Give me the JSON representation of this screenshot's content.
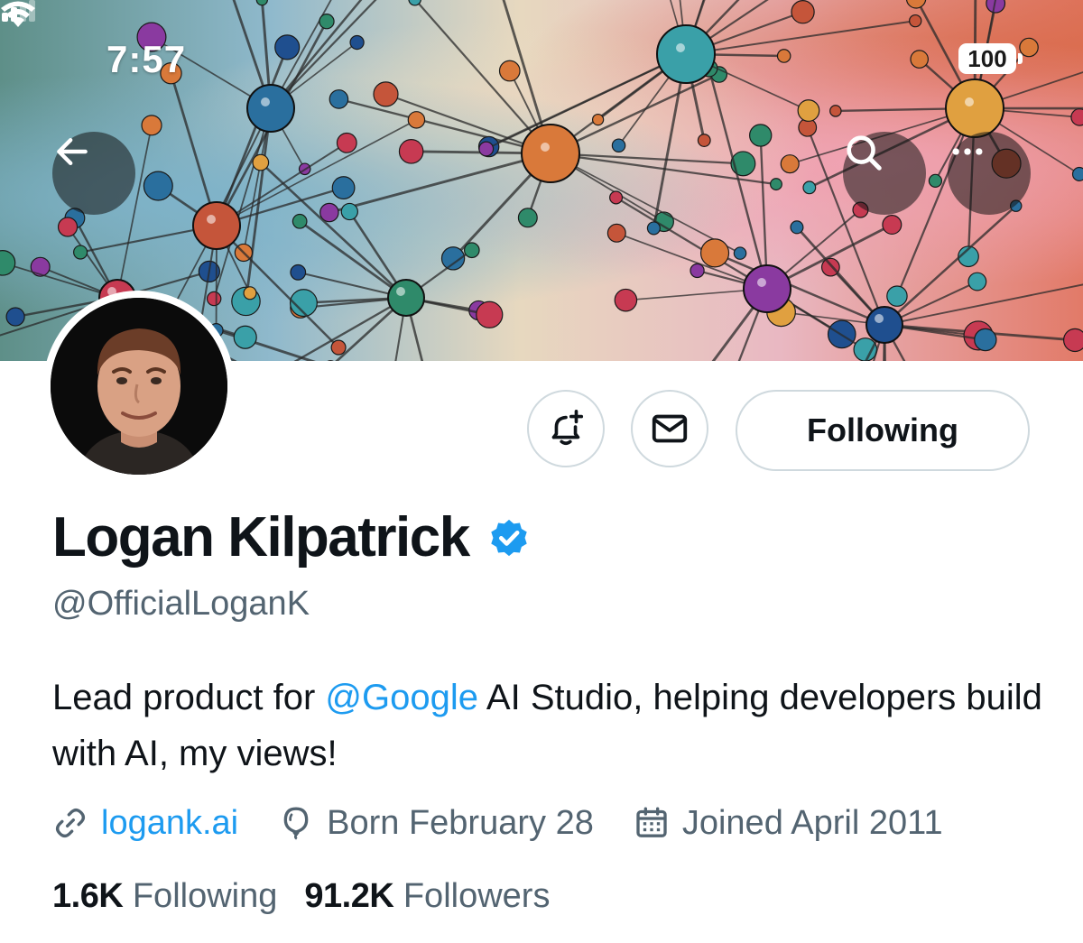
{
  "status_bar": {
    "time": "7:57",
    "battery": "100"
  },
  "header": {
    "icons": {
      "back": "arrow-left-icon",
      "search": "search-icon",
      "more": "more-horizontal-icon"
    }
  },
  "profile": {
    "display_name": "Logan Kilpatrick",
    "handle": "@OfficialLoganK",
    "verified": true,
    "bio": {
      "part1": "Lead product for ",
      "mention": "@Google",
      "part2": " AI Studio, helping developers build with AI, my views!"
    },
    "website": "logank.ai",
    "birthday": "Born February 28",
    "joined": "Joined April 2011",
    "following_count": "1.6K",
    "following_label": "Following",
    "followers_count": "91.2K",
    "followers_label": "Followers"
  },
  "actions": {
    "following_button": "Following"
  },
  "colors": {
    "accent": "#1d9bf0",
    "text_primary": "#0f1419",
    "text_secondary": "#536471",
    "border": "#cfd9de"
  }
}
